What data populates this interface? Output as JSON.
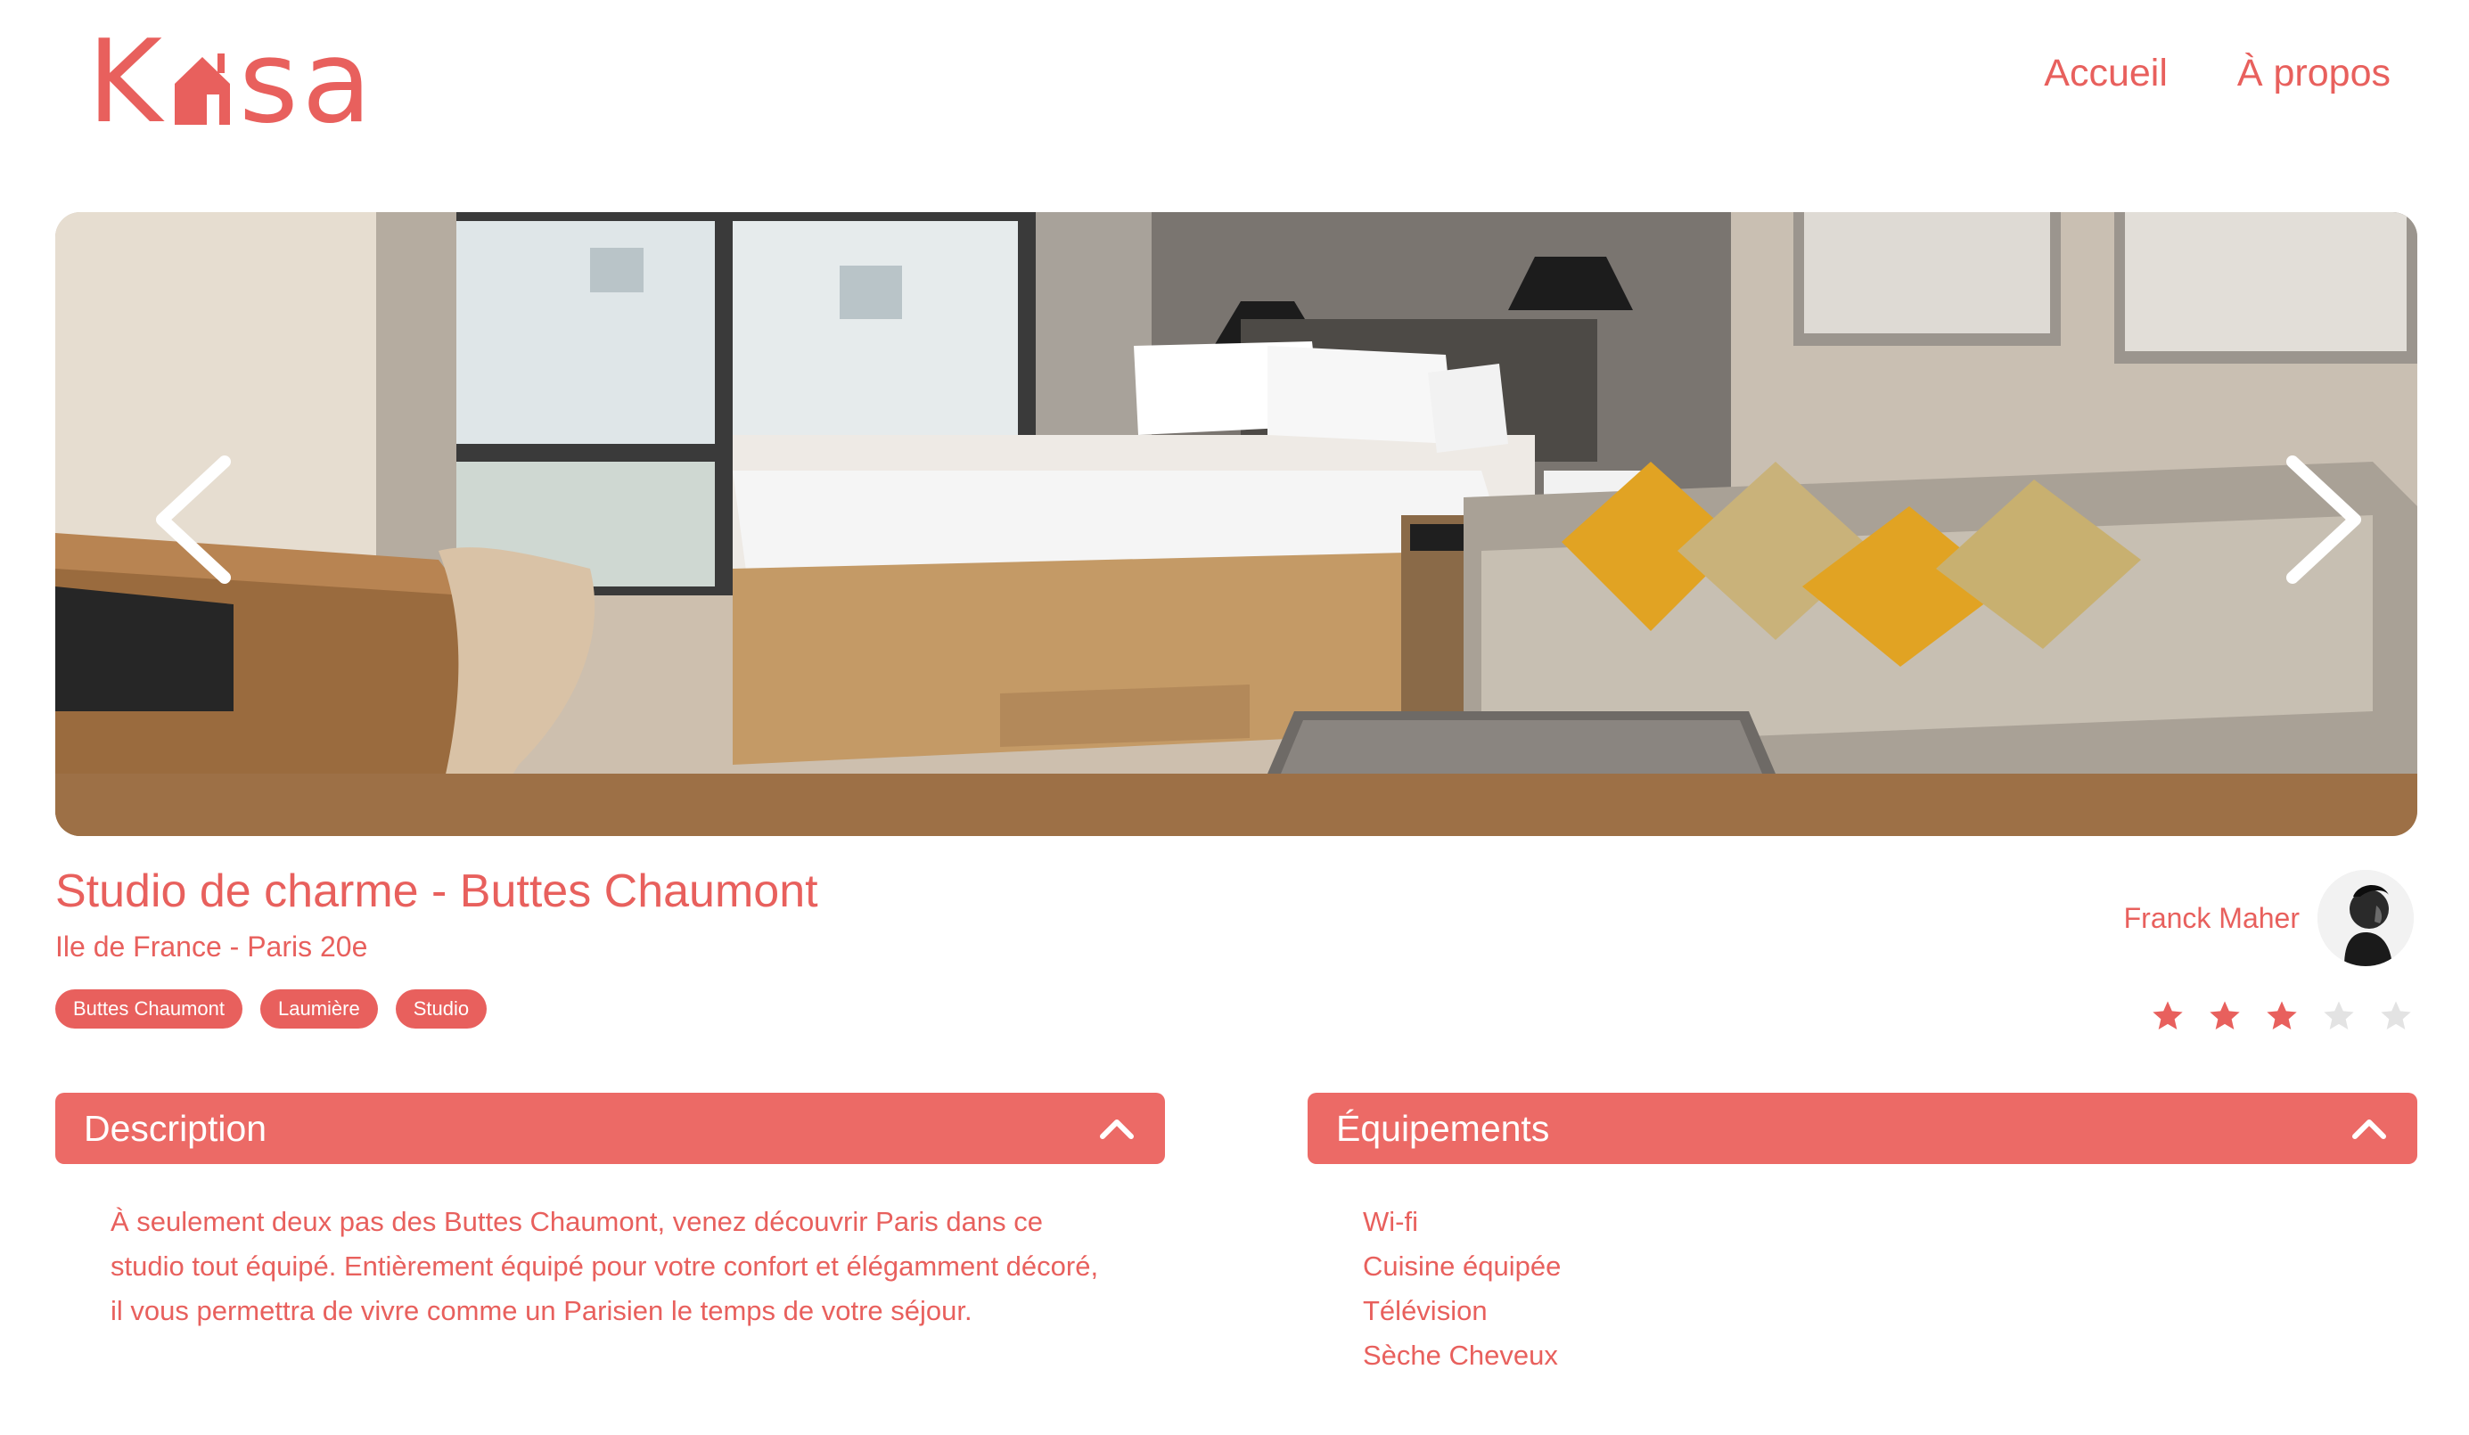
{
  "brand": {
    "logo_left": "K",
    "logo_right": "sa",
    "color": "#e8605d"
  },
  "nav": {
    "home_label": "Accueil",
    "about_label": "À propos"
  },
  "carousel": {
    "prev_icon": "chevron-left-icon",
    "next_icon": "chevron-right-icon"
  },
  "listing": {
    "title": "Studio de charme - Buttes Chaumont",
    "location": "Ile de France - Paris 20e",
    "tags": [
      "Buttes Chaumont",
      "Laumière",
      "Studio"
    ],
    "host_name": "Franck Maher",
    "rating": 3,
    "rating_max": 5
  },
  "description": {
    "header": "Description",
    "text": "À seulement deux pas des Buttes Chaumont, venez découvrir Paris dans ce studio tout équipé. Entièrement équipé pour votre confort et élégamment décoré, il vous permettra de vivre comme un Parisien le temps de votre séjour."
  },
  "equipments": {
    "header": "Équipements",
    "items": [
      "Wi-fi",
      "Cuisine équipée",
      "Télévision",
      "Sèche Cheveux"
    ]
  },
  "colors": {
    "accent": "#e8605d",
    "star_off": "#e3e3e3"
  }
}
